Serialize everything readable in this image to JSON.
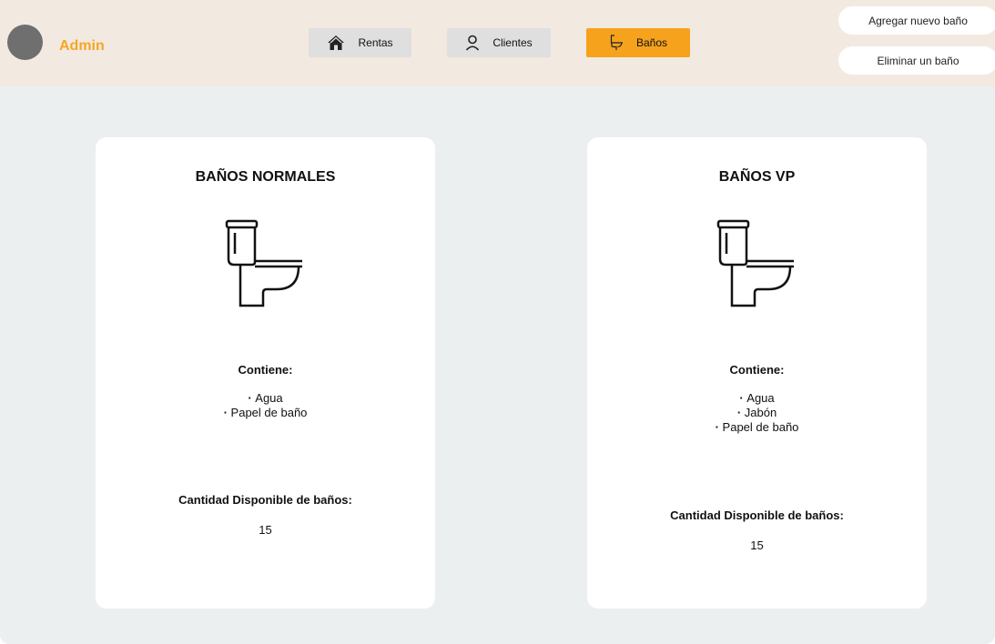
{
  "header": {
    "admin_label": "Admin",
    "avatar_icon": "user-avatar",
    "nav": [
      {
        "label": "Rentas",
        "icon": "home-icon",
        "active": false
      },
      {
        "label": "Clientes",
        "icon": "user-icon",
        "active": false
      },
      {
        "label": "Baños",
        "icon": "toilet-icon",
        "active": true
      }
    ],
    "actions": {
      "add_label": "Agregar nuevo baño",
      "delete_label": "Eliminar un baño"
    }
  },
  "colors": {
    "accent": "#f6a21d",
    "admin_text": "#f5a623",
    "header_bg": "#f2e9e1",
    "page_bg": "#eceff0",
    "nav_bg": "#dfdfdf"
  },
  "cards": [
    {
      "title": "BAÑOS NORMALES",
      "icon": "toilet-icon",
      "contains_label": "Contiene:",
      "items": [
        "Agua",
        "Papel de baño"
      ],
      "qty_label": "Cantidad Disponible de baños:",
      "qty_value": "15"
    },
    {
      "title": "BAÑOS VP",
      "icon": "toilet-icon",
      "contains_label": "Contiene:",
      "items": [
        "Agua",
        "Jabón",
        "Papel de baño"
      ],
      "qty_label": "Cantidad Disponible de baños:",
      "qty_value": "15"
    }
  ]
}
